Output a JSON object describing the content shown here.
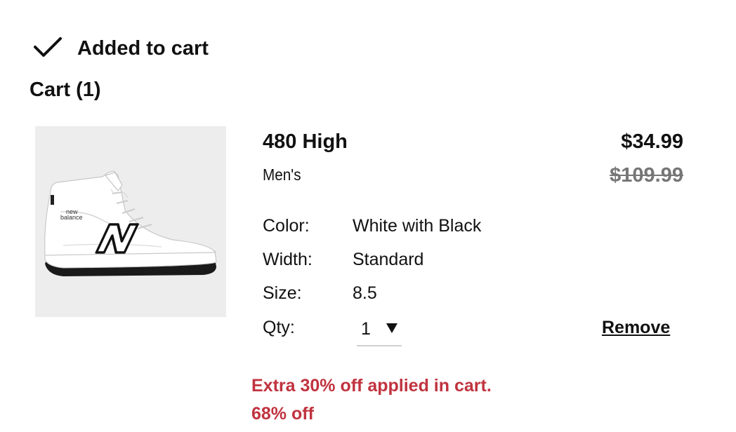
{
  "header": {
    "added_label": "Added to cart",
    "cart_heading": "Cart (1)"
  },
  "item": {
    "image_icon": "sneaker-image",
    "brand_line1": "new",
    "brand_line2": "balance",
    "name": "480 High",
    "gender": "Men's",
    "price_current": "$34.99",
    "price_original": "$109.99",
    "attributes": {
      "color": {
        "label": "Color:",
        "value": "White with Black"
      },
      "width": {
        "label": "Width:",
        "value": "Standard"
      },
      "size": {
        "label": "Size:",
        "value": "8.5"
      }
    },
    "qty": {
      "label": "Qty:",
      "value": "1"
    },
    "remove_label": "Remove",
    "promo": "Extra 30% off applied in cart.",
    "discount": "68% off"
  },
  "colors": {
    "promo": "#c0333f",
    "original_price": "#767676",
    "image_bg": "#ededed"
  }
}
